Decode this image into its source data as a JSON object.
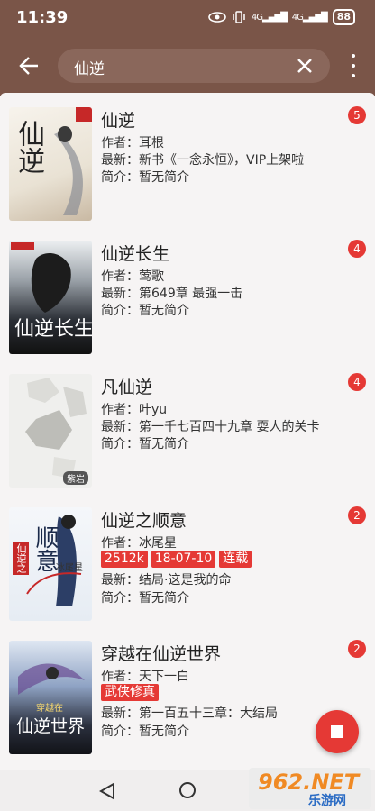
{
  "status": {
    "time": "11:39",
    "signal1": "4G",
    "signal2": "4G",
    "battery": "88"
  },
  "search": {
    "query": "仙逆"
  },
  "colors": {
    "appbar": "#7a5548",
    "accent": "#e53935"
  },
  "results": [
    {
      "title": "仙逆",
      "author": "作者：耳根",
      "latest": "最新：新书《一念永恒》，VIP上架啦",
      "intro": "简介：暂无简介",
      "badge": "5",
      "tags": []
    },
    {
      "title": "仙逆长生",
      "author": "作者：莺歌",
      "latest": "最新：第649章 最强一击",
      "intro": "简介：暂无简介",
      "badge": "4",
      "tags": []
    },
    {
      "title": "凡仙逆",
      "author": "作者：叶yu",
      "latest": "最新：第一千七百四十九章 耍人的关卡",
      "intro": "简介：暂无简介",
      "badge": "4",
      "tags": []
    },
    {
      "title": "仙逆之顺意",
      "author": "作者：冰尾星",
      "latest": "最新：结局·这是我的命",
      "intro": "简介：暂无简介",
      "badge": "2",
      "tags": [
        "2512k",
        "18-07-10",
        "连载"
      ]
    },
    {
      "title": "穿越在仙逆世界",
      "author": "作者：天下一白",
      "latest": "最新：第一百五十三章：大结局",
      "intro": "简介：暂无简介",
      "badge": "2",
      "tags": [
        "武侠修真"
      ]
    }
  ],
  "covers": {
    "c1": "仙逆",
    "c2": "仙逆长生",
    "c3": "紫岩",
    "c4a": "仙逆之",
    "c4b": "顺意",
    "c4c": "冰尾星",
    "c5a": "穿越在",
    "c5b": "仙逆世界"
  },
  "watermark": {
    "num": "962.NET",
    "sub": "乐游网"
  }
}
